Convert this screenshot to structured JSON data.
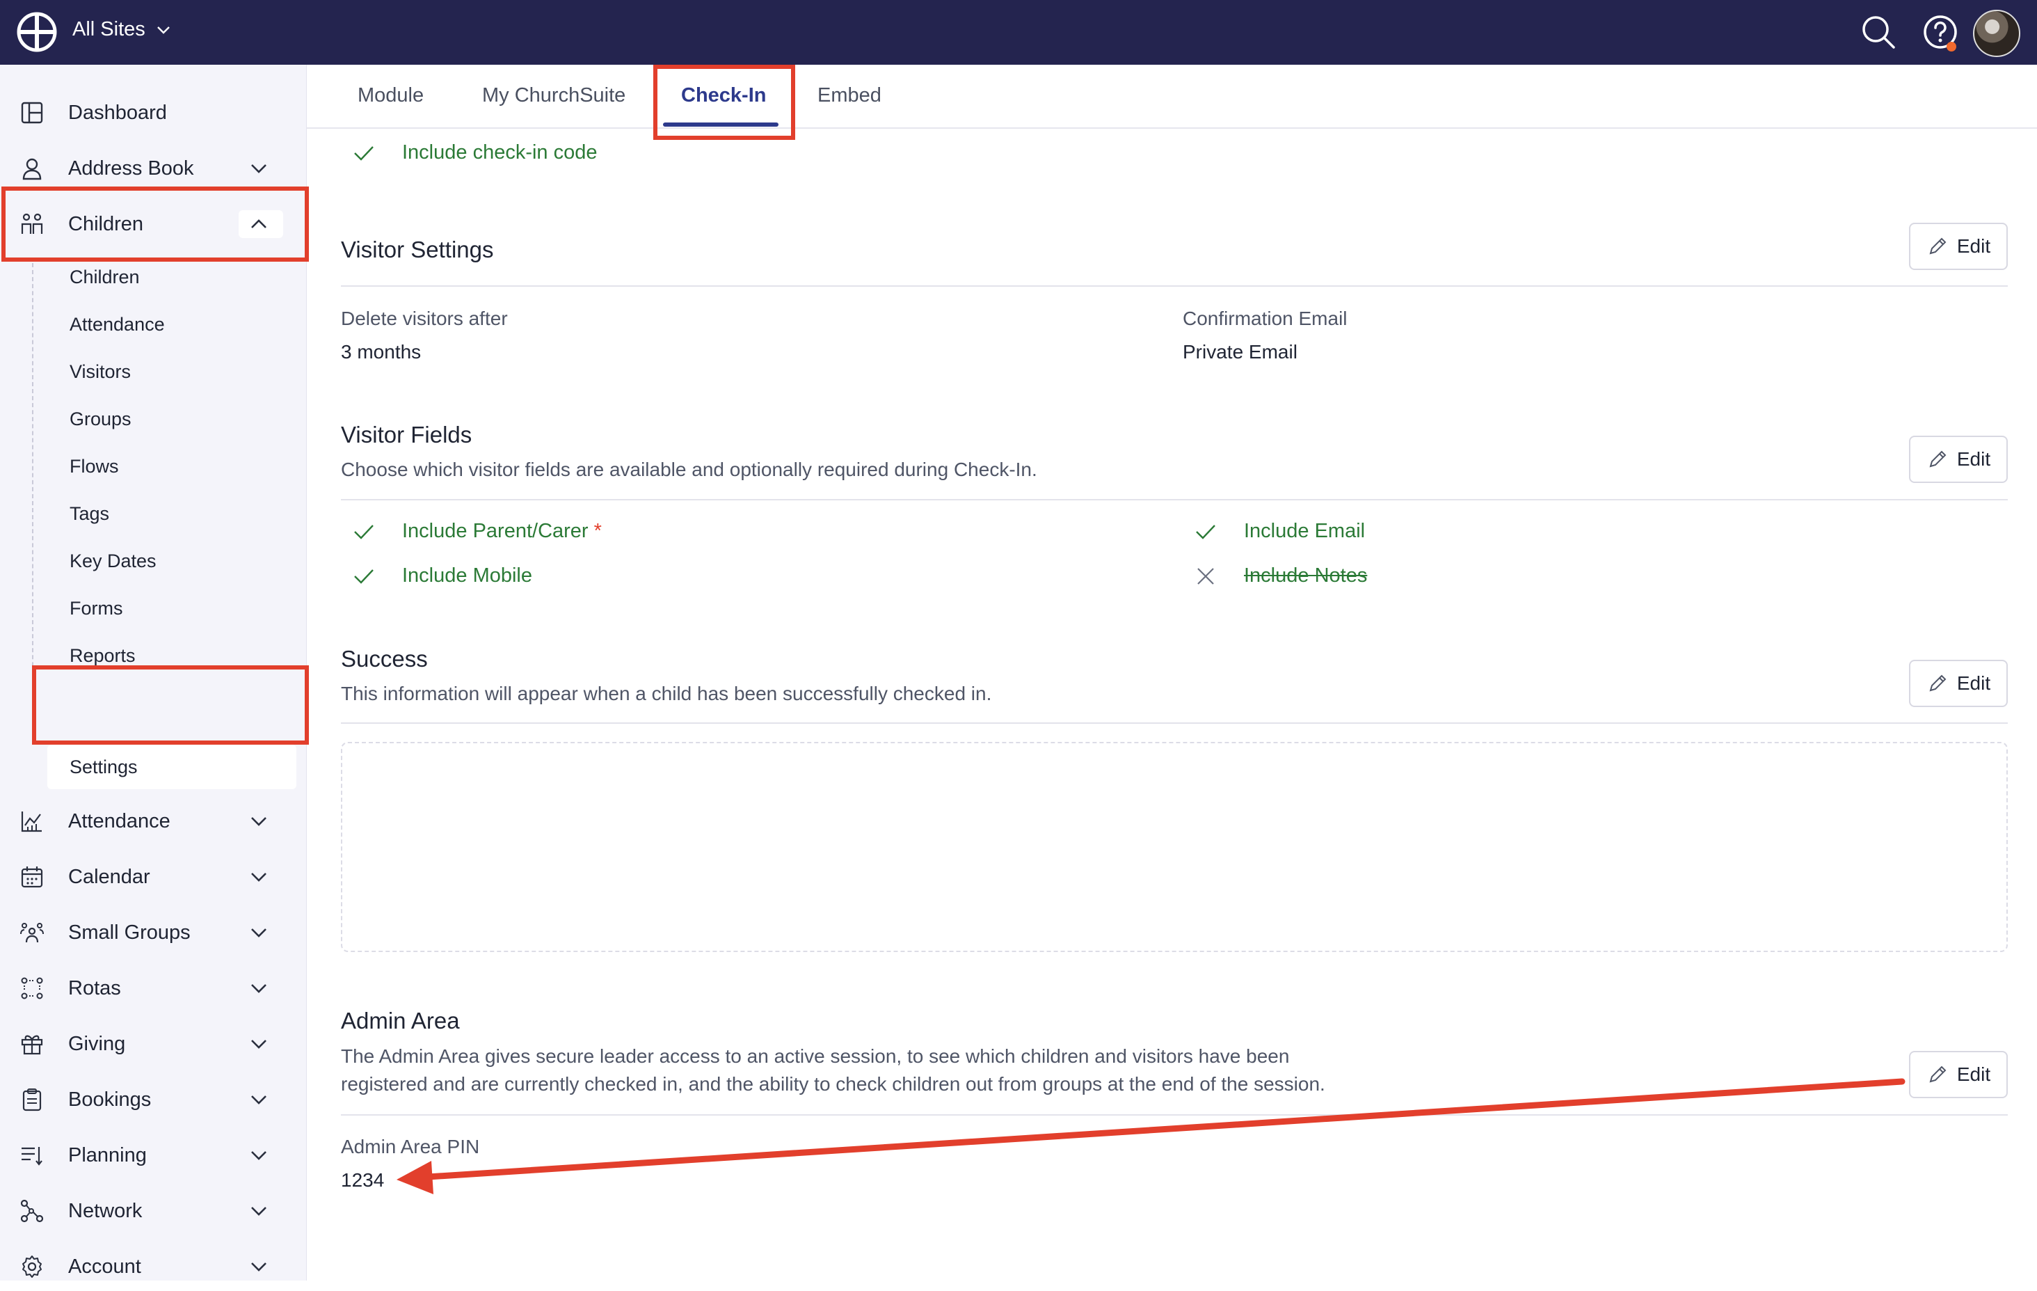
{
  "topbar": {
    "site_selector": "All Sites",
    "icons": [
      "search-icon",
      "help-icon",
      "user-avatar"
    ]
  },
  "sidebar": {
    "items": [
      {
        "label": "Dashboard",
        "icon": "dashboard-icon"
      },
      {
        "label": "Address Book",
        "icon": "person-icon"
      },
      {
        "label": "Children",
        "icon": "children-icon"
      },
      {
        "label": "Attendance",
        "icon": "chart-icon"
      },
      {
        "label": "Calendar",
        "icon": "calendar-icon"
      },
      {
        "label": "Small Groups",
        "icon": "groups-icon"
      },
      {
        "label": "Rotas",
        "icon": "rotas-icon"
      },
      {
        "label": "Giving",
        "icon": "gift-icon"
      },
      {
        "label": "Bookings",
        "icon": "clipboard-icon"
      },
      {
        "label": "Planning",
        "icon": "planning-icon"
      },
      {
        "label": "Network",
        "icon": "network-icon"
      },
      {
        "label": "Account",
        "icon": "gear-icon"
      }
    ],
    "children_sub": [
      "Children",
      "Attendance",
      "Visitors",
      "Groups",
      "Flows",
      "Tags",
      "Key Dates",
      "Forms",
      "Reports",
      "Settings"
    ]
  },
  "tabs": [
    "Module",
    "My ChurchSuite",
    "Check-In",
    "Embed"
  ],
  "content": {
    "checkin_code": "Include check-in code",
    "visitor_settings": {
      "title": "Visitor Settings",
      "delete_label": "Delete visitors after",
      "delete_value": "3 months",
      "email_label": "Confirmation Email",
      "email_value": "Private Email"
    },
    "visitor_fields": {
      "title": "Visitor Fields",
      "description": "Choose which visitor fields are available and optionally required during Check-In.",
      "parent_carer": "Include Parent/Carer",
      "required_mark": "*",
      "email": "Include Email",
      "mobile": "Include Mobile",
      "notes": "Include Notes"
    },
    "success": {
      "title": "Success",
      "description": "This information will appear when a child has been successfully checked in."
    },
    "admin_area": {
      "title": "Admin Area",
      "description_line1": "The Admin Area gives secure leader access to an active session, to see which children and visitors have been",
      "description_line2": "registered and are currently checked in, and the ability to check children out from groups at the end of the session.",
      "pin_label": "Admin Area PIN",
      "pin_value": "1234"
    },
    "edit_label": "Edit"
  },
  "colors": {
    "topbar": "#24244f",
    "accent": "#2d3a8c",
    "enabled_green": "#2b7a36",
    "annotation_red": "#e23f2c"
  }
}
